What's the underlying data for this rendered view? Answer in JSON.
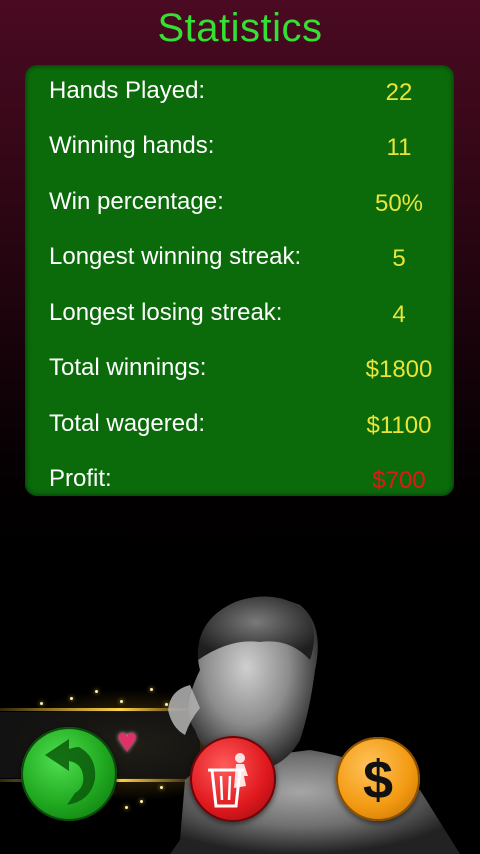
{
  "header": {
    "title": "Statistics"
  },
  "stats": [
    {
      "label": "Hands Played:",
      "value": "22"
    },
    {
      "label": "Winning hands:",
      "value": "11"
    },
    {
      "label": "Win percentage:",
      "value": "50%"
    },
    {
      "label": "Longest winning streak:",
      "value": "5"
    },
    {
      "label": "Longest losing streak:",
      "value": "4"
    },
    {
      "label": "Total winnings:",
      "value": "$1800"
    },
    {
      "label": "Total wagered:",
      "value": "$1100"
    },
    {
      "label": "Profit:",
      "value": "$700"
    }
  ],
  "colors": {
    "title": "#33e033",
    "panel": "#0b6b0b",
    "value": "#e8e43a",
    "profit": "#e01818",
    "back_button": "#1fa61f",
    "delete_button": "#e0191e",
    "money_button": "#f39a12"
  },
  "icons": {
    "back": "back-arrow-icon",
    "delete": "trash-icon",
    "money": "dollar-icon",
    "club": "club-suit-icon",
    "heart": "heart-suit-icon"
  }
}
